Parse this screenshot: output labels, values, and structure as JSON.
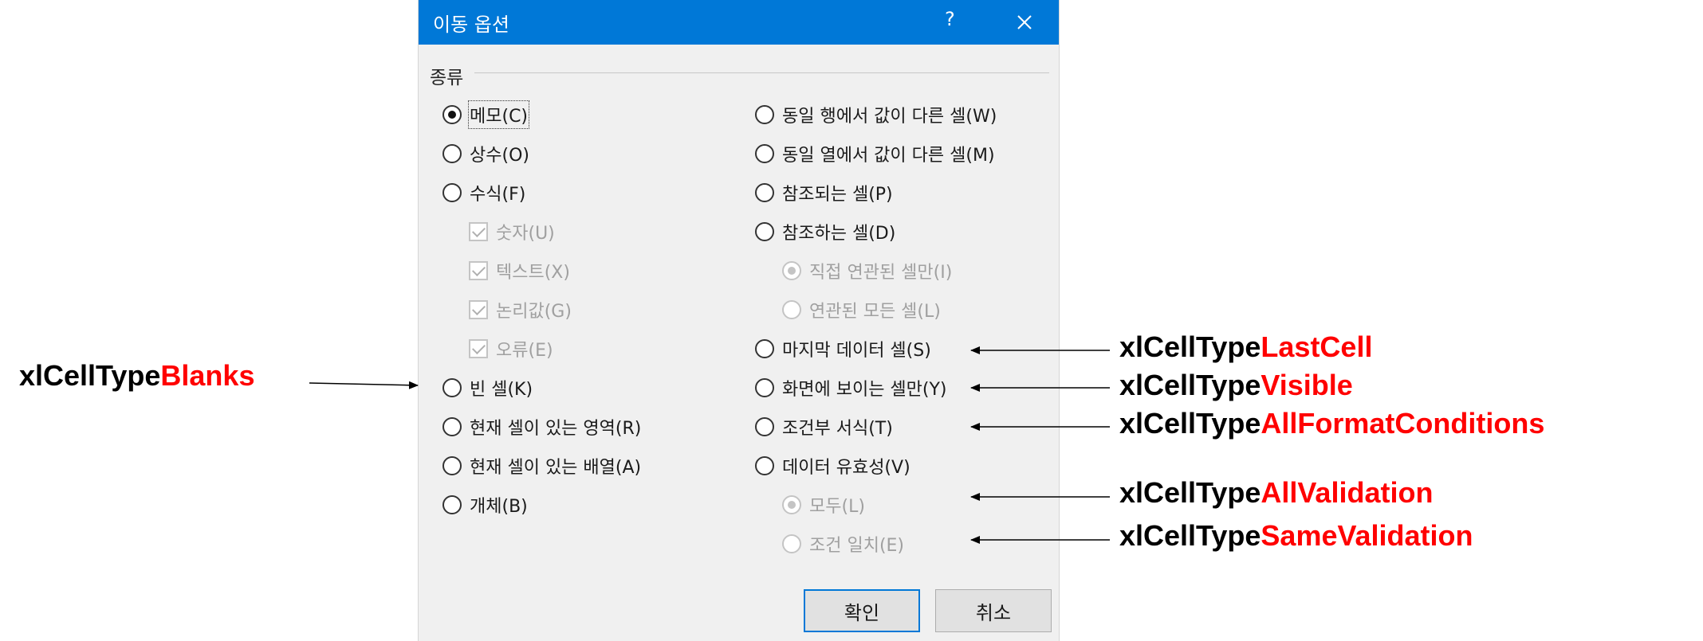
{
  "dialog": {
    "title": "이동 옵션",
    "help": "?",
    "group_label": "종류",
    "left_options": [
      {
        "label": "메모(C)",
        "type": "radio",
        "checked": true,
        "disabled": false
      },
      {
        "label": "상수(O)",
        "type": "radio",
        "checked": false,
        "disabled": false
      },
      {
        "label": "수식(F)",
        "type": "radio",
        "checked": false,
        "disabled": false
      },
      {
        "label": "숫자(U)",
        "type": "checkbox",
        "checked": true,
        "disabled": true
      },
      {
        "label": "텍스트(X)",
        "type": "checkbox",
        "checked": true,
        "disabled": true
      },
      {
        "label": "논리값(G)",
        "type": "checkbox",
        "checked": true,
        "disabled": true
      },
      {
        "label": "오류(E)",
        "type": "checkbox",
        "checked": true,
        "disabled": true
      },
      {
        "label": "빈 셀(K)",
        "type": "radio",
        "checked": false,
        "disabled": false
      },
      {
        "label": "현재 셀이 있는 영역(R)",
        "type": "radio",
        "checked": false,
        "disabled": false
      },
      {
        "label": "현재 셀이 있는 배열(A)",
        "type": "radio",
        "checked": false,
        "disabled": false
      },
      {
        "label": "개체(B)",
        "type": "radio",
        "checked": false,
        "disabled": false
      }
    ],
    "right_options": [
      {
        "label": "동일 행에서 값이 다른 셀(W)",
        "type": "radio",
        "checked": false,
        "disabled": false
      },
      {
        "label": "동일 열에서 값이 다른 셀(M)",
        "type": "radio",
        "checked": false,
        "disabled": false
      },
      {
        "label": "참조되는 셀(P)",
        "type": "radio",
        "checked": false,
        "disabled": false
      },
      {
        "label": "참조하는 셀(D)",
        "type": "radio",
        "checked": false,
        "disabled": false
      },
      {
        "label": "직접 연관된 셀만(I)",
        "type": "radio",
        "checked": true,
        "disabled": true
      },
      {
        "label": "연관된 모든 셀(L)",
        "type": "radio",
        "checked": false,
        "disabled": true
      },
      {
        "label": "마지막 데이터 셀(S)",
        "type": "radio",
        "checked": false,
        "disabled": false
      },
      {
        "label": "화면에 보이는 셀만(Y)",
        "type": "radio",
        "checked": false,
        "disabled": false
      },
      {
        "label": "조건부 서식(T)",
        "type": "radio",
        "checked": false,
        "disabled": false
      },
      {
        "label": "데이터 유효성(V)",
        "type": "radio",
        "checked": false,
        "disabled": false
      },
      {
        "label": "모두(L)",
        "type": "radio",
        "checked": true,
        "disabled": true
      },
      {
        "label": "조건 일치(E)",
        "type": "radio",
        "checked": false,
        "disabled": true
      }
    ],
    "ok_label": "확인",
    "cancel_label": "취소"
  },
  "annotations": {
    "prefix": "xlCellType",
    "blanks": "Blanks",
    "last_cell": "LastCell",
    "visible": "Visible",
    "all_format_conditions": "AllFormatConditions",
    "all_validation": "AllValidation",
    "same_validation": "SameValidation"
  },
  "colors": {
    "titlebar": "#0078d7",
    "annotation_highlight": "#ff0000"
  }
}
